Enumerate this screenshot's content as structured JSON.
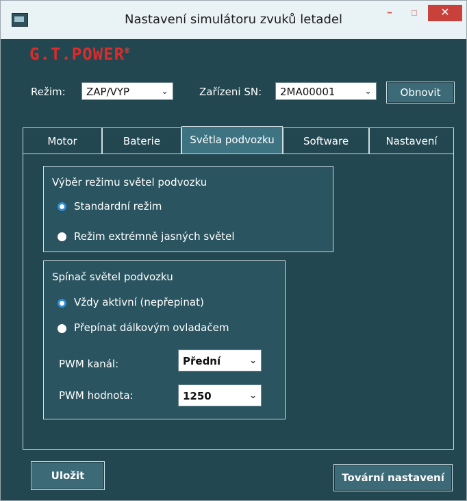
{
  "window": {
    "title": "Nastavení simulátoru zvuků letadel"
  },
  "logo": {
    "text": "G.T.POWER",
    "mark": "®"
  },
  "header": {
    "mode_label": "Režim:",
    "mode_value": "ZAP/VYP",
    "device_label": "Zařízeni SN:",
    "device_value": "2MA00001",
    "refresh_label": "Obnovit"
  },
  "tabs": [
    "Motor",
    "Baterie",
    "Světla podvozku",
    "Software",
    "Nastavení"
  ],
  "active_tab": "Světla podvozku",
  "mode_group": {
    "title": "Výběr režimu světel podvozku",
    "options": [
      "Standardní režim",
      "Režim extrémně jasných světel"
    ],
    "selected": "Standardní režim"
  },
  "switch_group": {
    "title": "Spínač světel podvozku",
    "options": [
      "Vždy aktivní (nepřepinat)",
      "Přepínat dálkovým ovladačem"
    ],
    "selected": "Vždy aktivní (nepřepinat)",
    "pwm_channel_label": "PWM kanál:",
    "pwm_channel_value": "Přední",
    "pwm_value_label": "PWM hodnota:",
    "pwm_value_value": "1250"
  },
  "footer": {
    "save_label": "Uložit",
    "factory_label": "Tovární nastavení"
  },
  "colors": {
    "background": "#234750",
    "accent_red": "#e02a2a",
    "button": "#3c6b77",
    "radio_selected": "#2e8bd6"
  },
  "icons": {
    "dropdown": "chevron-down-icon",
    "app": "app-icon"
  }
}
